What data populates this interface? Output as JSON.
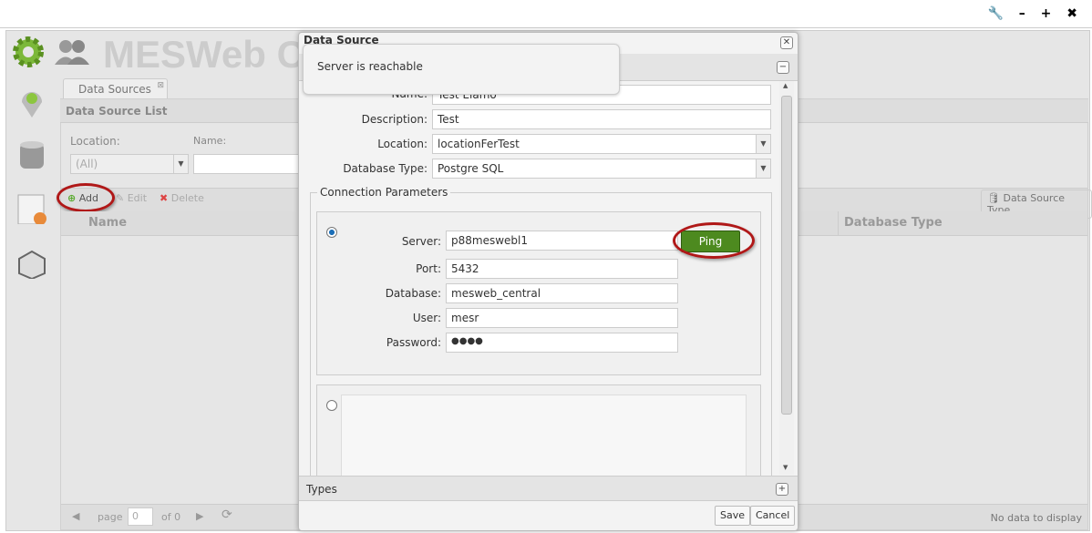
{
  "window": {
    "controls": "🔧 – + ✖"
  },
  "app": {
    "title": "MESWeb C"
  },
  "tab": {
    "label": "Data Sources"
  },
  "panel": {
    "title": "Data Source List",
    "location_label": "Location:",
    "location_value": "(All)",
    "name_label": "Name:"
  },
  "toolbar": {
    "add": "Add",
    "edit": "Edit",
    "delete": "Delete",
    "data_source_type": "Data Source Type"
  },
  "grid": {
    "columns": [
      "Name",
      "Database Type"
    ]
  },
  "pager": {
    "page": "page",
    "page_value": "0",
    "of": "of 0",
    "status": "No data to display"
  },
  "dialog": {
    "title": "Data Source",
    "fields": [
      {
        "label": "Name:",
        "value": "Test Elamo"
      },
      {
        "label": "Description:",
        "value": "Test"
      },
      {
        "label": "Location:",
        "value": "locationFerTest"
      },
      {
        "label": "Database Type:",
        "value": "Postgre SQL"
      }
    ],
    "connection_legend": "Connection Parameters",
    "conn": [
      {
        "label": "Server:",
        "value": "p88meswebl1"
      },
      {
        "label": "Port:",
        "value": "5432"
      },
      {
        "label": "Database:",
        "value": "mesweb_central"
      },
      {
        "label": "User:",
        "value": "mesr"
      },
      {
        "label": "Password:",
        "value": "●●●●"
      }
    ],
    "ping": "Ping",
    "types": "Types",
    "save": "Save",
    "cancel": "Cancel"
  },
  "toast": {
    "message": "Server is reachable"
  },
  "colors": {
    "ping_green": "#4d8a1f",
    "highlight_ring": "#b01818"
  }
}
